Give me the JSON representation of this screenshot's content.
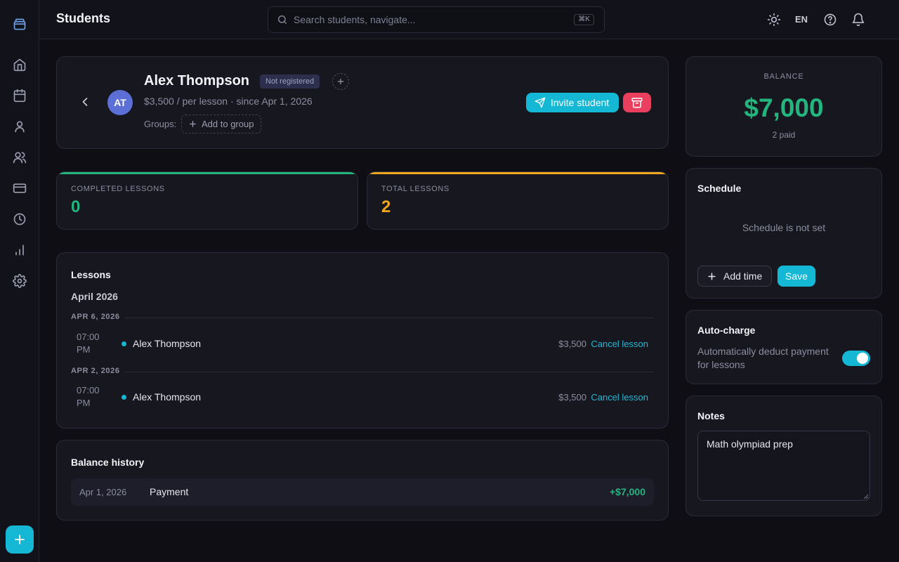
{
  "header": {
    "title": "Students",
    "search_placeholder": "Search students, navigate...",
    "shortcut": "⌘K",
    "language": "EN"
  },
  "sidebar": {
    "items": [
      {
        "name": "home",
        "icon": "home-icon"
      },
      {
        "name": "calendar",
        "icon": "calendar-icon"
      },
      {
        "name": "students",
        "icon": "user-icon"
      },
      {
        "name": "groups",
        "icon": "users-icon"
      },
      {
        "name": "payments",
        "icon": "credit-card-icon"
      },
      {
        "name": "history",
        "icon": "clock-icon"
      },
      {
        "name": "analytics",
        "icon": "bar-chart-icon"
      },
      {
        "name": "settings",
        "icon": "gear-icon"
      }
    ]
  },
  "student": {
    "initials": "AT",
    "name": "Alex Thompson",
    "status": "Not registered",
    "price_line": "$3,500 / per lesson  · since Apr 1, 2026",
    "groups_label": "Groups:",
    "add_group_label": "Add to group",
    "invite_label": "Invite student"
  },
  "stats": {
    "completed": {
      "label": "COMPLETED LESSONS",
      "value": "0",
      "color": "#23b57d"
    },
    "total": {
      "label": "TOTAL LESSONS",
      "value": "2",
      "color": "#f0a61e"
    }
  },
  "lessons": {
    "title": "Lessons",
    "month": "April 2026",
    "days": [
      {
        "date": "APR 6, 2026",
        "time": "07:00 PM",
        "student": "Alex Thompson",
        "price": "$3,500",
        "action": "Cancel lesson"
      },
      {
        "date": "APR 2, 2026",
        "time": "07:00 PM",
        "student": "Alex Thompson",
        "price": "$3,500",
        "action": "Cancel lesson"
      }
    ]
  },
  "balance_history": {
    "title": "Balance history",
    "rows": [
      {
        "date": "Apr 1, 2026",
        "label": "Payment",
        "amount": "+$7,000"
      }
    ]
  },
  "balance": {
    "label": "BALANCE",
    "value": "$7,000",
    "sub": "2 paid"
  },
  "schedule": {
    "title": "Schedule",
    "empty": "Schedule is not set",
    "add_time": "Add time",
    "save": "Save"
  },
  "autocharge": {
    "title": "Auto-charge",
    "description": "Automatically deduct payment for lessons",
    "enabled": true
  },
  "notes": {
    "title": "Notes",
    "text": "Math olympiad prep"
  },
  "colors": {
    "accent": "#14b8d4",
    "success": "#23b57d",
    "warning": "#f0a61e",
    "danger": "#ea3f5e"
  }
}
